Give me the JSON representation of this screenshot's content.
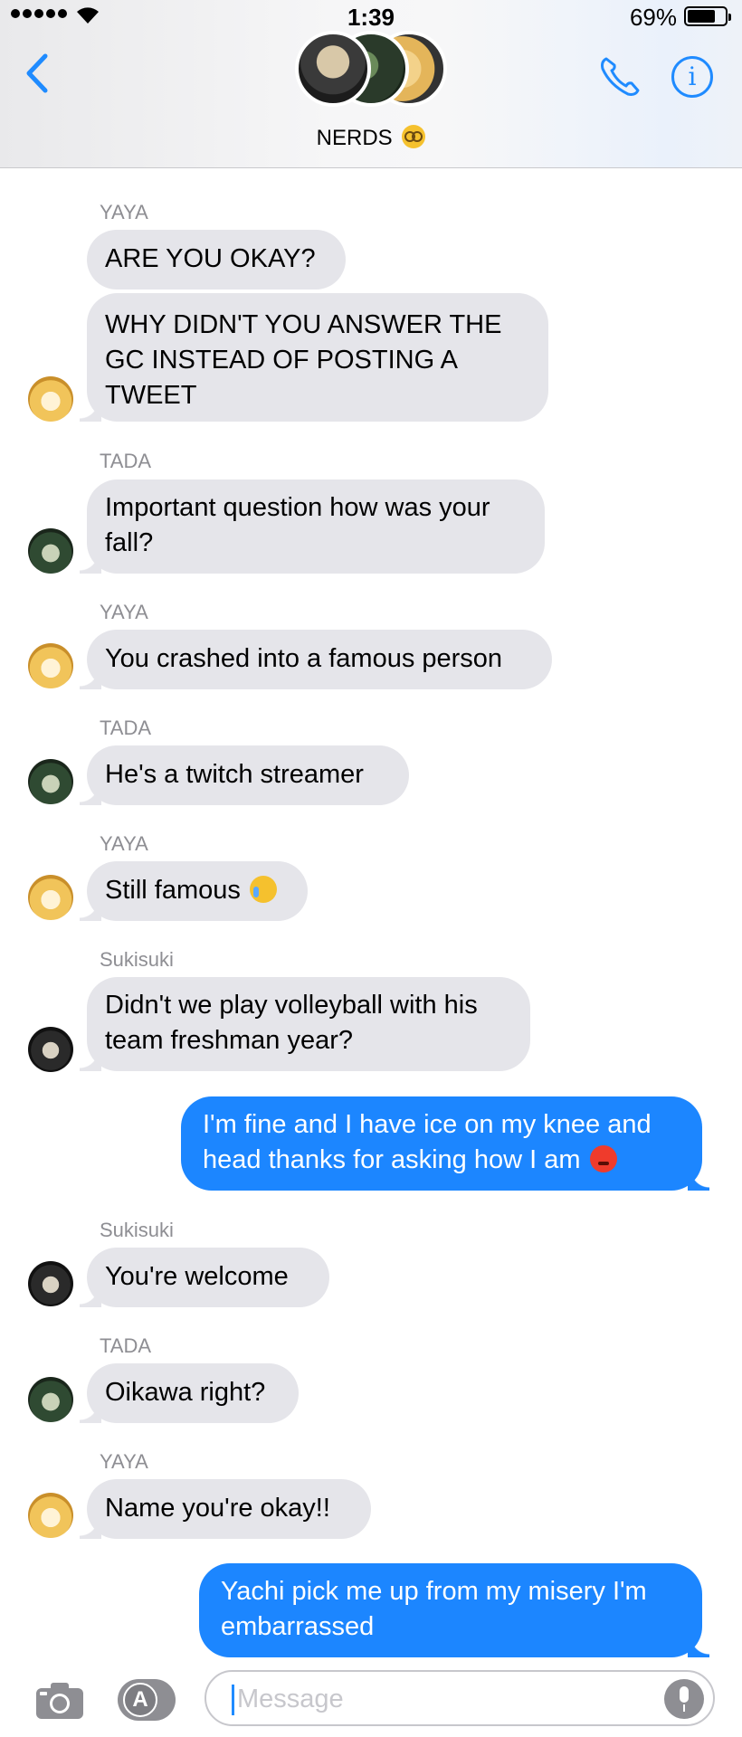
{
  "status_bar": {
    "time": "1:39",
    "battery_percent": "69%",
    "battery_level": 0.69,
    "signal_bars": 5
  },
  "header": {
    "group_name": "NERDS",
    "group_emoji": "nerd-face-emoji",
    "back_icon": "chevron-left-icon",
    "call_icon": "phone-icon",
    "info_icon": "info-icon",
    "info_glyph": "i"
  },
  "messages": [
    {
      "sender": "YAYA",
      "text": "ARE YOU OKAY?",
      "from_me": false
    },
    {
      "sender": "",
      "text": "WHY DIDN'T YOU ANSWER THE GC INSTEAD OF POSTING A TWEET",
      "from_me": false
    },
    {
      "sender": "TADA",
      "text": "Important question how was your fall?",
      "from_me": false
    },
    {
      "sender": "YAYA",
      "text": "You crashed into a famous person",
      "from_me": false
    },
    {
      "sender": "TADA",
      "text": "He's a twitch streamer",
      "from_me": false
    },
    {
      "sender": "YAYA",
      "text": "Still famous",
      "emoji": "crying-face-emoji",
      "from_me": false
    },
    {
      "sender": "Sukisuki",
      "text": "Didn't we play volleyball with his team freshman year?",
      "from_me": false
    },
    {
      "sender": "",
      "text": "I'm fine and I have ice on my knee and head thanks for asking how I am",
      "emoji": "angry-face-emoji",
      "from_me": true
    },
    {
      "sender": "Sukisuki",
      "text": "You're welcome",
      "from_me": false
    },
    {
      "sender": "TADA",
      "text": "Oikawa right?",
      "from_me": false
    },
    {
      "sender": "YAYA",
      "text": "Name you're okay!!",
      "from_me": false
    },
    {
      "sender": "",
      "text": "Yachi pick me up from my misery I'm embarrassed",
      "from_me": true
    }
  ],
  "input_bar": {
    "placeholder": "Message",
    "value": "",
    "camera_icon": "camera-icon",
    "apps_icon": "app-store-icon",
    "apps_glyph": "A",
    "mic_icon": "microphone-icon"
  },
  "colors": {
    "accent": "#1f8bff",
    "outgoing_bubble": "#1c86ff",
    "incoming_bubble": "#e5e5ea",
    "sender_label": "#8e8e93"
  }
}
